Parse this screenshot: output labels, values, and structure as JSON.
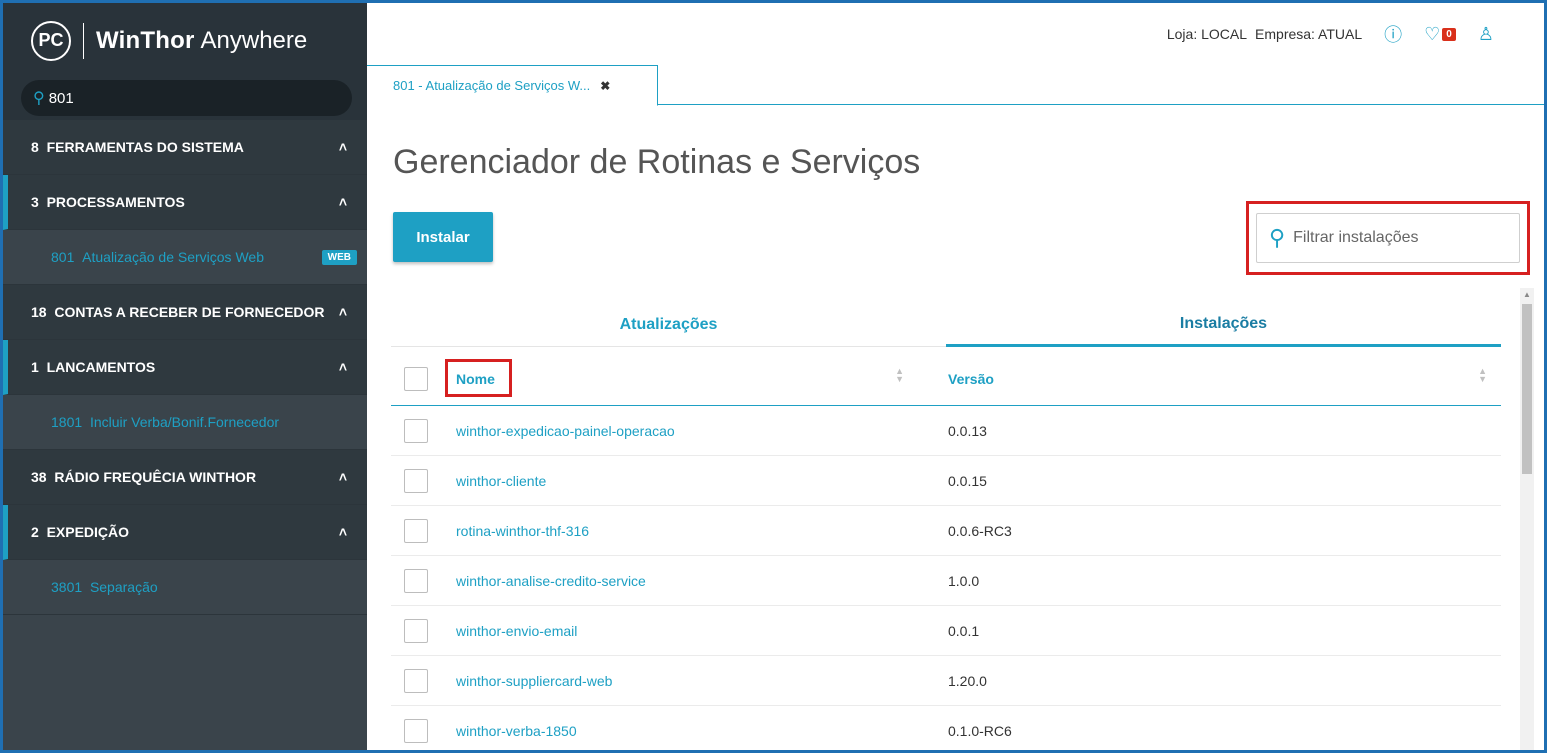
{
  "brand": {
    "logo": "PC",
    "name_bold": "WinThor",
    "name_light": "Anywhere"
  },
  "search": {
    "value": "801",
    "icon": "search-icon"
  },
  "sidebar": {
    "sections": [
      {
        "code": "8",
        "label": "FERRAMENTAS DO SISTEMA",
        "level": 1
      },
      {
        "code": "3",
        "label": "PROCESSAMENTOS",
        "level": 2
      },
      {
        "code": "801",
        "label": "Atualização de Serviços Web",
        "badge": "WEB",
        "level": 3
      },
      {
        "code": "18",
        "label": "CONTAS A RECEBER DE FORNECEDOR",
        "level": 1
      },
      {
        "code": "1",
        "label": "LANCAMENTOS",
        "level": 2
      },
      {
        "code": "1801",
        "label": "Incluir Verba/Bonif.Fornecedor",
        "level": 3
      },
      {
        "code": "38",
        "label": "RÁDIO FREQUÊCIA WINTHOR",
        "level": 1
      },
      {
        "code": "2",
        "label": "EXPEDIÇÃO",
        "level": 2
      },
      {
        "code": "3801",
        "label": "Separação",
        "level": 3
      }
    ]
  },
  "topbar": {
    "loja": "Loja: LOCAL",
    "empresa": "Empresa: ATUAL",
    "notifications": "0"
  },
  "tab": {
    "label": "801 - Atualização de Serviços W...",
    "close": "✖"
  },
  "page": {
    "title": "Gerenciador de Rotinas e Serviços",
    "install_label": "Instalar",
    "filter_placeholder": "Filtrar instalações"
  },
  "subtabs": [
    "Atualizações",
    "Instalações"
  ],
  "table": {
    "columns": [
      "Nome",
      "Versão"
    ],
    "rows": [
      {
        "name": "winthor-expedicao-painel-operacao",
        "version": "0.0.13"
      },
      {
        "name": "winthor-cliente",
        "version": "0.0.15"
      },
      {
        "name": "rotina-winthor-thf-316",
        "version": "0.0.6-RC3"
      },
      {
        "name": "winthor-analise-credito-service",
        "version": "1.0.0"
      },
      {
        "name": "winthor-envio-email",
        "version": "0.0.1"
      },
      {
        "name": "winthor-suppliercard-web",
        "version": "1.20.0"
      },
      {
        "name": "winthor-verba-1850",
        "version": "0.1.0-RC6"
      }
    ]
  },
  "colors": {
    "accent": "#1ea0c4",
    "sidebar": "#3a444b",
    "highlight": "#d62020"
  }
}
